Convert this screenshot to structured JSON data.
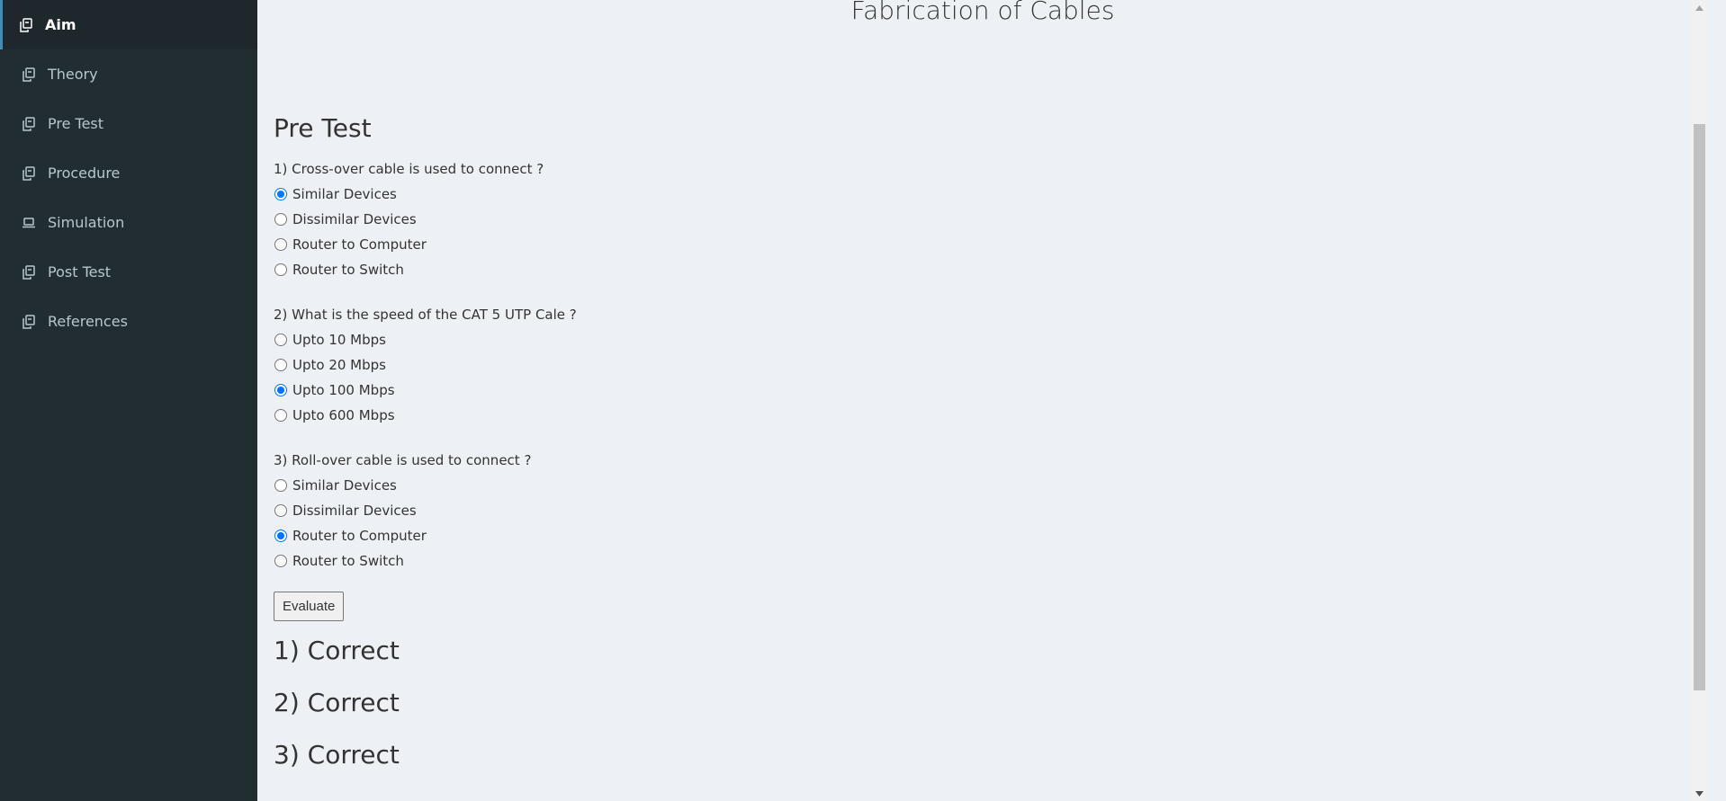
{
  "sidebar": {
    "items": [
      {
        "label": "Aim",
        "icon": "copy-icon",
        "active": true
      },
      {
        "label": "Theory",
        "icon": "copy-icon",
        "active": false
      },
      {
        "label": "Pre Test",
        "icon": "copy-icon",
        "active": false
      },
      {
        "label": "Procedure",
        "icon": "copy-icon",
        "active": false
      },
      {
        "label": "Simulation",
        "icon": "laptop-icon",
        "active": false
      },
      {
        "label": "Post Test",
        "icon": "copy-icon",
        "active": false
      },
      {
        "label": "References",
        "icon": "copy-icon",
        "active": false
      }
    ]
  },
  "header": {
    "title": "Fabrication of Cables"
  },
  "pretest": {
    "title": "Pre Test",
    "questions": [
      {
        "text": "1) Cross-over cable is used to connect ?",
        "options": [
          "Similar Devices",
          "Dissimilar Devices",
          "Router to Computer",
          "Router to Switch"
        ],
        "selected": 0
      },
      {
        "text": "2) What is the speed of the CAT 5 UTP Cale ?",
        "options": [
          "Upto 10 Mbps",
          "Upto 20 Mbps",
          "Upto 100 Mbps",
          "Upto 600 Mbps"
        ],
        "selected": 2
      },
      {
        "text": "3) Roll-over cable is used to connect ?",
        "options": [
          "Similar Devices",
          "Dissimilar Devices",
          "Router to Computer",
          "Router to Switch"
        ],
        "selected": 2
      }
    ],
    "evaluate_label": "Evaluate",
    "results": [
      "1) Correct",
      "2) Correct",
      "3) Correct"
    ]
  },
  "colors": {
    "sidebar_bg": "#222d32",
    "sidebar_active_bg": "#1e282c",
    "content_bg": "#edf1f5",
    "radio_checked": "#0075ff"
  }
}
